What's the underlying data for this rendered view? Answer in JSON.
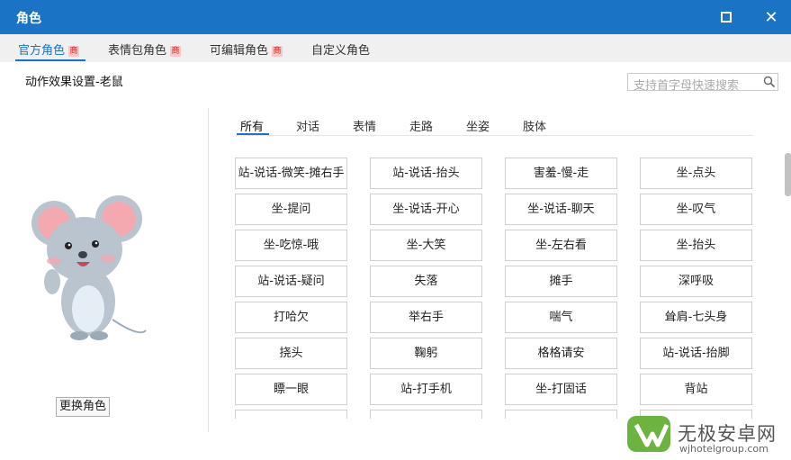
{
  "window": {
    "title": "角色"
  },
  "tabs": [
    {
      "label": "官方角色",
      "badge": "商"
    },
    {
      "label": "表情包角色",
      "badge": "商"
    },
    {
      "label": "可编辑角色",
      "badge": "商"
    },
    {
      "label": "自定义角色"
    }
  ],
  "search": {
    "placeholder": "支持首字母快速搜索"
  },
  "subtitle": "动作效果设置-老鼠",
  "change_button": "更换角色",
  "categories": [
    "所有",
    "对话",
    "表情",
    "走路",
    "坐姿",
    "肢体"
  ],
  "actions": [
    "站-说话-微笑-摊右手",
    "站-说话-抬头",
    "害羞-慢-走",
    "坐-点头",
    "坐-提问",
    "坐-说话-开心",
    "坐-说话-聊天",
    "坐-叹气",
    "坐-吃惊-哦",
    "坐-大笑",
    "坐-左右看",
    "坐-抬头",
    "站-说话-疑问",
    "失落",
    "摊手",
    "深呼吸",
    "打哈欠",
    "举右手",
    "喘气",
    "耸肩-七头身",
    "挠头",
    "鞠躬",
    "格格请安",
    "站-说话-抬脚",
    "瞟一眼",
    "站-打手机",
    "坐-打固话",
    "背站",
    "",
    "",
    "",
    ""
  ],
  "watermark": {
    "title": "无极安卓网",
    "url": "wjhotelgroup.com"
  },
  "colors": {
    "accent": "#1a73c5",
    "badge_bg": "#f6c8c8",
    "badge_text": "#dd2222"
  }
}
